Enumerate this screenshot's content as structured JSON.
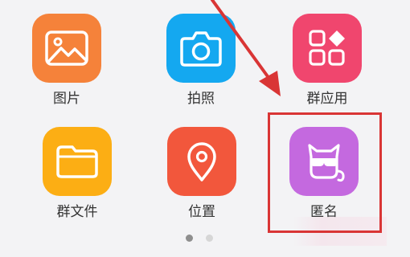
{
  "grid": {
    "items": [
      {
        "label": "图片",
        "icon": "image-icon",
        "color": "#f5823a"
      },
      {
        "label": "拍照",
        "icon": "camera-icon",
        "color": "#14a8f0"
      },
      {
        "label": "群应用",
        "icon": "app-grid-icon",
        "color": "#f0466e"
      },
      {
        "label": "群文件",
        "icon": "folder-icon",
        "color": "#fcae14"
      },
      {
        "label": "位置",
        "icon": "location-pin-icon",
        "color": "#f2573c"
      },
      {
        "label": "匿名",
        "icon": "anonymous-mask-icon",
        "color": "#c469df"
      }
    ]
  },
  "pager": {
    "pages": 2,
    "current": 1
  },
  "annotation": {
    "highlight_color": "#d93535"
  }
}
